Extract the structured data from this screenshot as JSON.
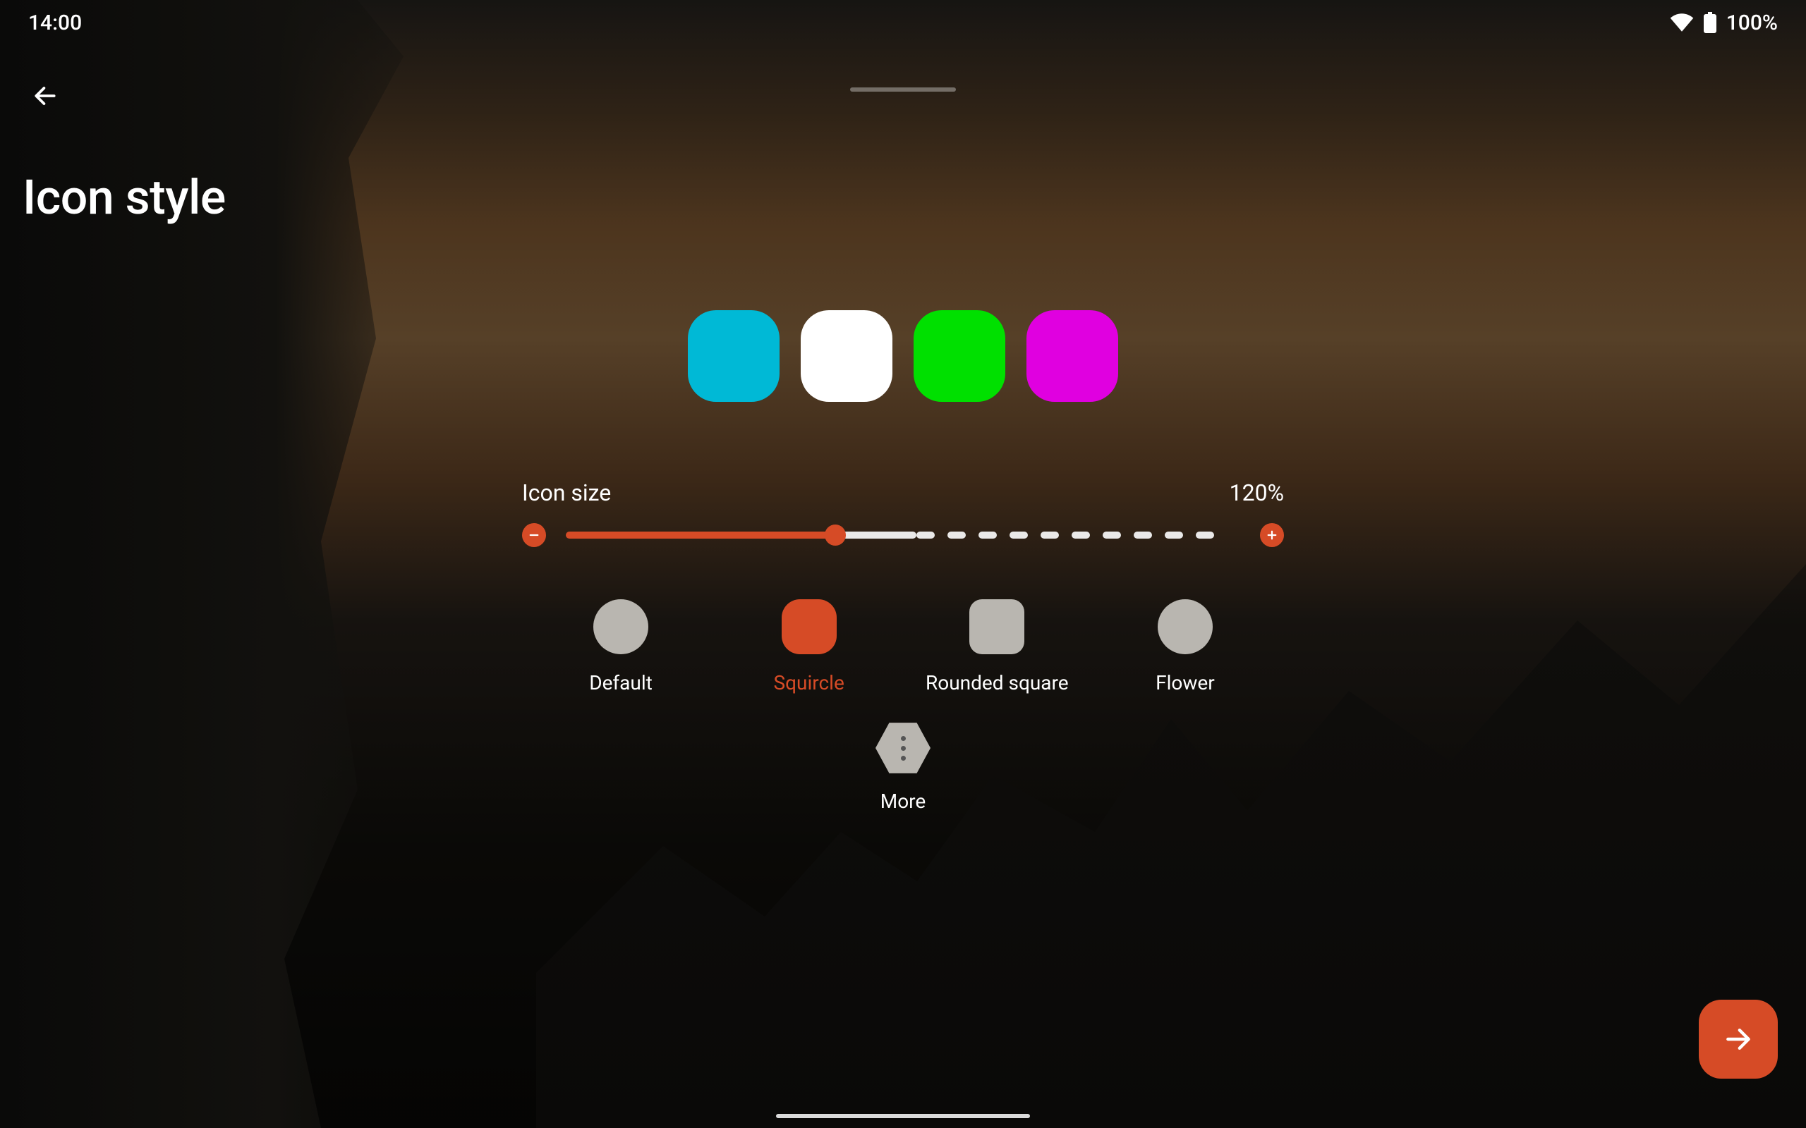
{
  "status": {
    "time": "14:00",
    "battery": "100%"
  },
  "page": {
    "title": "Icon style"
  },
  "preview": {
    "colors": [
      "#00b9d6",
      "#ffffff",
      "#00e000",
      "#e000e0"
    ]
  },
  "size": {
    "label": "Icon size",
    "value": "120%",
    "fill_pct": 40,
    "solid_end_pct": 52,
    "dash_count": 10
  },
  "shapes": [
    {
      "id": "default",
      "label": "Default",
      "selected": false
    },
    {
      "id": "squircle",
      "label": "Squircle",
      "selected": true
    },
    {
      "id": "rounded-square",
      "label": "Rounded square",
      "selected": false
    },
    {
      "id": "flower",
      "label": "Flower",
      "selected": false
    }
  ],
  "more": {
    "label": "More"
  },
  "accent": "#d64b26"
}
